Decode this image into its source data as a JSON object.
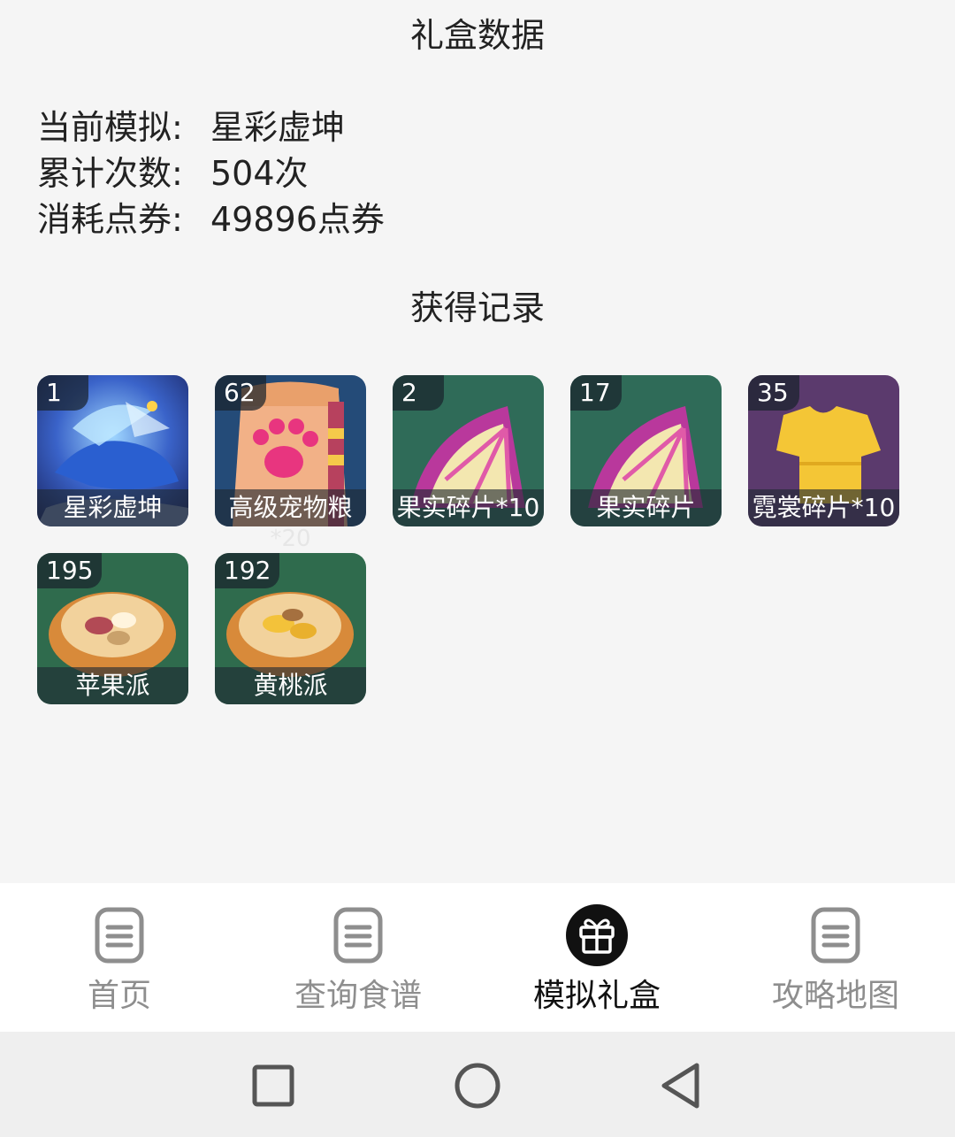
{
  "header": {
    "title": "礼盒数据"
  },
  "stats": [
    {
      "label": "当前模拟:",
      "value": "星彩虚坤"
    },
    {
      "label": "累计次数:",
      "value": "504次"
    },
    {
      "label": "消耗点券:",
      "value": "49896点券"
    }
  ],
  "records_title": "获得记录",
  "records": [
    {
      "count": "1",
      "name": "星彩虚坤",
      "icon": "star-whale-icon"
    },
    {
      "count": "62",
      "name": "高级宠物粮",
      "overflow": "*20",
      "icon": "pet-food-bag-icon"
    },
    {
      "count": "2",
      "name": "果实碎片*10",
      "icon": "fruit-fragment-icon"
    },
    {
      "count": "17",
      "name": "果实碎片",
      "icon": "fruit-fragment-icon"
    },
    {
      "count": "35",
      "name": "霓裳碎片*10",
      "icon": "shirt-fragment-icon"
    },
    {
      "count": "195",
      "name": "苹果派",
      "icon": "apple-pie-icon"
    },
    {
      "count": "192",
      "name": "黄桃派",
      "icon": "peach-pie-icon"
    }
  ],
  "nav": [
    {
      "label": "首页",
      "icon": "document-icon",
      "active": false
    },
    {
      "label": "查询食谱",
      "icon": "document-icon",
      "active": false
    },
    {
      "label": "模拟礼盒",
      "icon": "gift-icon",
      "active": true
    },
    {
      "label": "攻略地图",
      "icon": "document-icon",
      "active": false
    }
  ],
  "system_nav": [
    "recent-apps-icon",
    "home-icon",
    "back-icon"
  ],
  "colors": {
    "active": "#111111",
    "inactive": "#8e8e8e",
    "background": "#f5f5f5"
  }
}
